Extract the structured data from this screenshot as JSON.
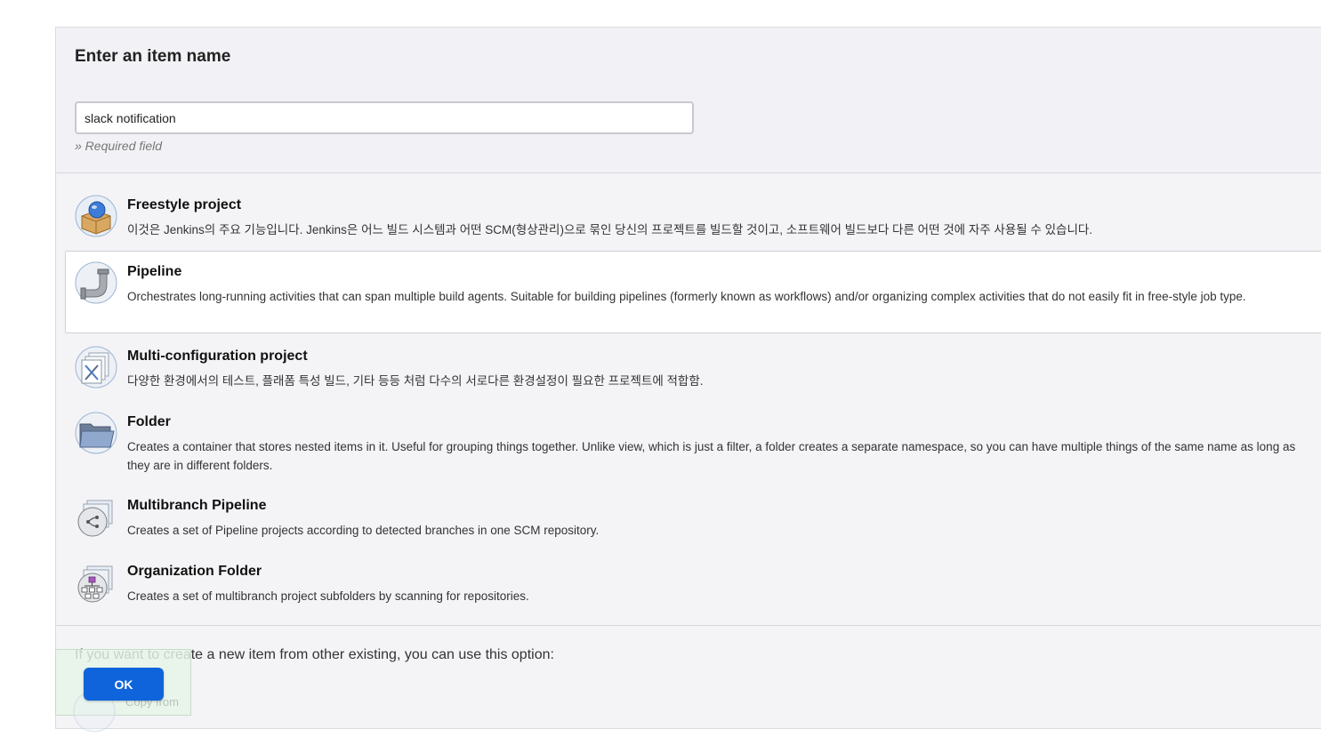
{
  "header": {
    "title": "Enter an item name",
    "input_value": "slack notification",
    "required_note": "» Required field"
  },
  "item_types": [
    {
      "name": "Freestyle project",
      "icon": "freestyle-project-icon",
      "selected": false,
      "description": "이것은 Jenkins의 주요 기능입니다. Jenkins은 어느 빌드 시스템과 어떤 SCM(형상관리)으로 묶인 당신의 프로젝트를 빌드할 것이고, 소프트웨어 빌드보다 다른 어떤 것에 자주 사용될 수 있습니다."
    },
    {
      "name": "Pipeline",
      "icon": "pipeline-icon",
      "selected": true,
      "description": "Orchestrates long-running activities that can span multiple build agents. Suitable for building pipelines (formerly known as workflows) and/or organizing complex activities that do not easily fit in free-style job type."
    },
    {
      "name": "Multi-configuration project",
      "icon": "multi-configuration-icon",
      "selected": false,
      "description": "다양한 환경에서의 테스트, 플래폼 특성 빌드, 기타 등등 처럼 다수의 서로다른 환경설정이 필요한 프로젝트에 적합함."
    },
    {
      "name": "Folder",
      "icon": "folder-icon",
      "selected": false,
      "description": "Creates a container that stores nested items in it. Useful for grouping things together. Unlike view, which is just a filter, a folder creates a separate namespace, so you can have multiple things of the same name as long as they are in different folders."
    },
    {
      "name": "Multibranch Pipeline",
      "icon": "multibranch-pipeline-icon",
      "selected": false,
      "description": "Creates a set of Pipeline projects according to detected branches in one SCM repository."
    },
    {
      "name": "Organization Folder",
      "icon": "organization-folder-icon",
      "selected": false,
      "description": "Creates a set of multibranch project subfolders by scanning for repositories."
    }
  ],
  "copy_section": {
    "text": "If you want to create a new item from other existing, you can use this option:",
    "copy_from_label": "Copy from"
  },
  "ok_button": {
    "label": "OK",
    "color": "#0f64dc"
  }
}
